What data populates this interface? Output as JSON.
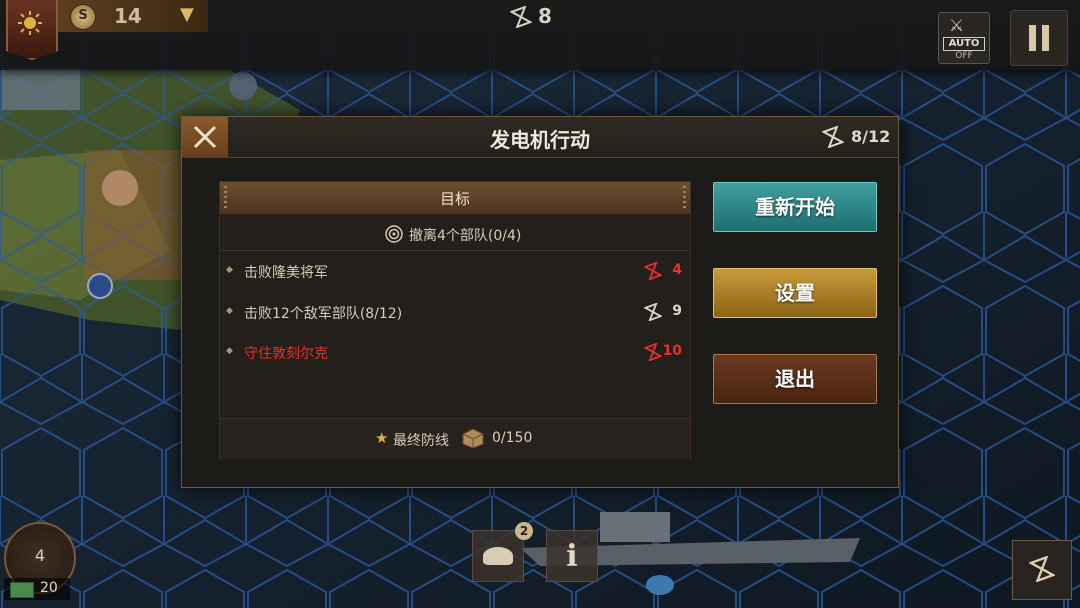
{
  "topbar": {
    "coins": "14",
    "coin_symbol": "S",
    "turn": "8",
    "auto_label": "AUTO",
    "auto_state": "OFF"
  },
  "dialog": {
    "title": "发电机行动",
    "turns": "8/12",
    "objectives": {
      "header": "目标",
      "main": "撤离4个部队(0/4)",
      "rows": [
        {
          "text": "击败隆美将军",
          "turns": "4",
          "urgent": true
        },
        {
          "text": "击败12个敌军部队(8/12)",
          "turns": "9",
          "urgent": false
        },
        {
          "text": "守住敦刻尔克",
          "turns": "10",
          "urgent": true
        }
      ],
      "reward_label": "最终防线",
      "reward_value": "0/150"
    },
    "buttons": {
      "restart": "重新开始",
      "settings": "设置",
      "exit": "退出"
    }
  },
  "hud": {
    "reserve": "4",
    "supply": "20",
    "officer_badge": "2",
    "info_label": "i"
  },
  "colors": {
    "restart": "#2a8a8c",
    "settings": "#b08428",
    "exit": "#5a3018",
    "urgent": "#e8302a"
  }
}
